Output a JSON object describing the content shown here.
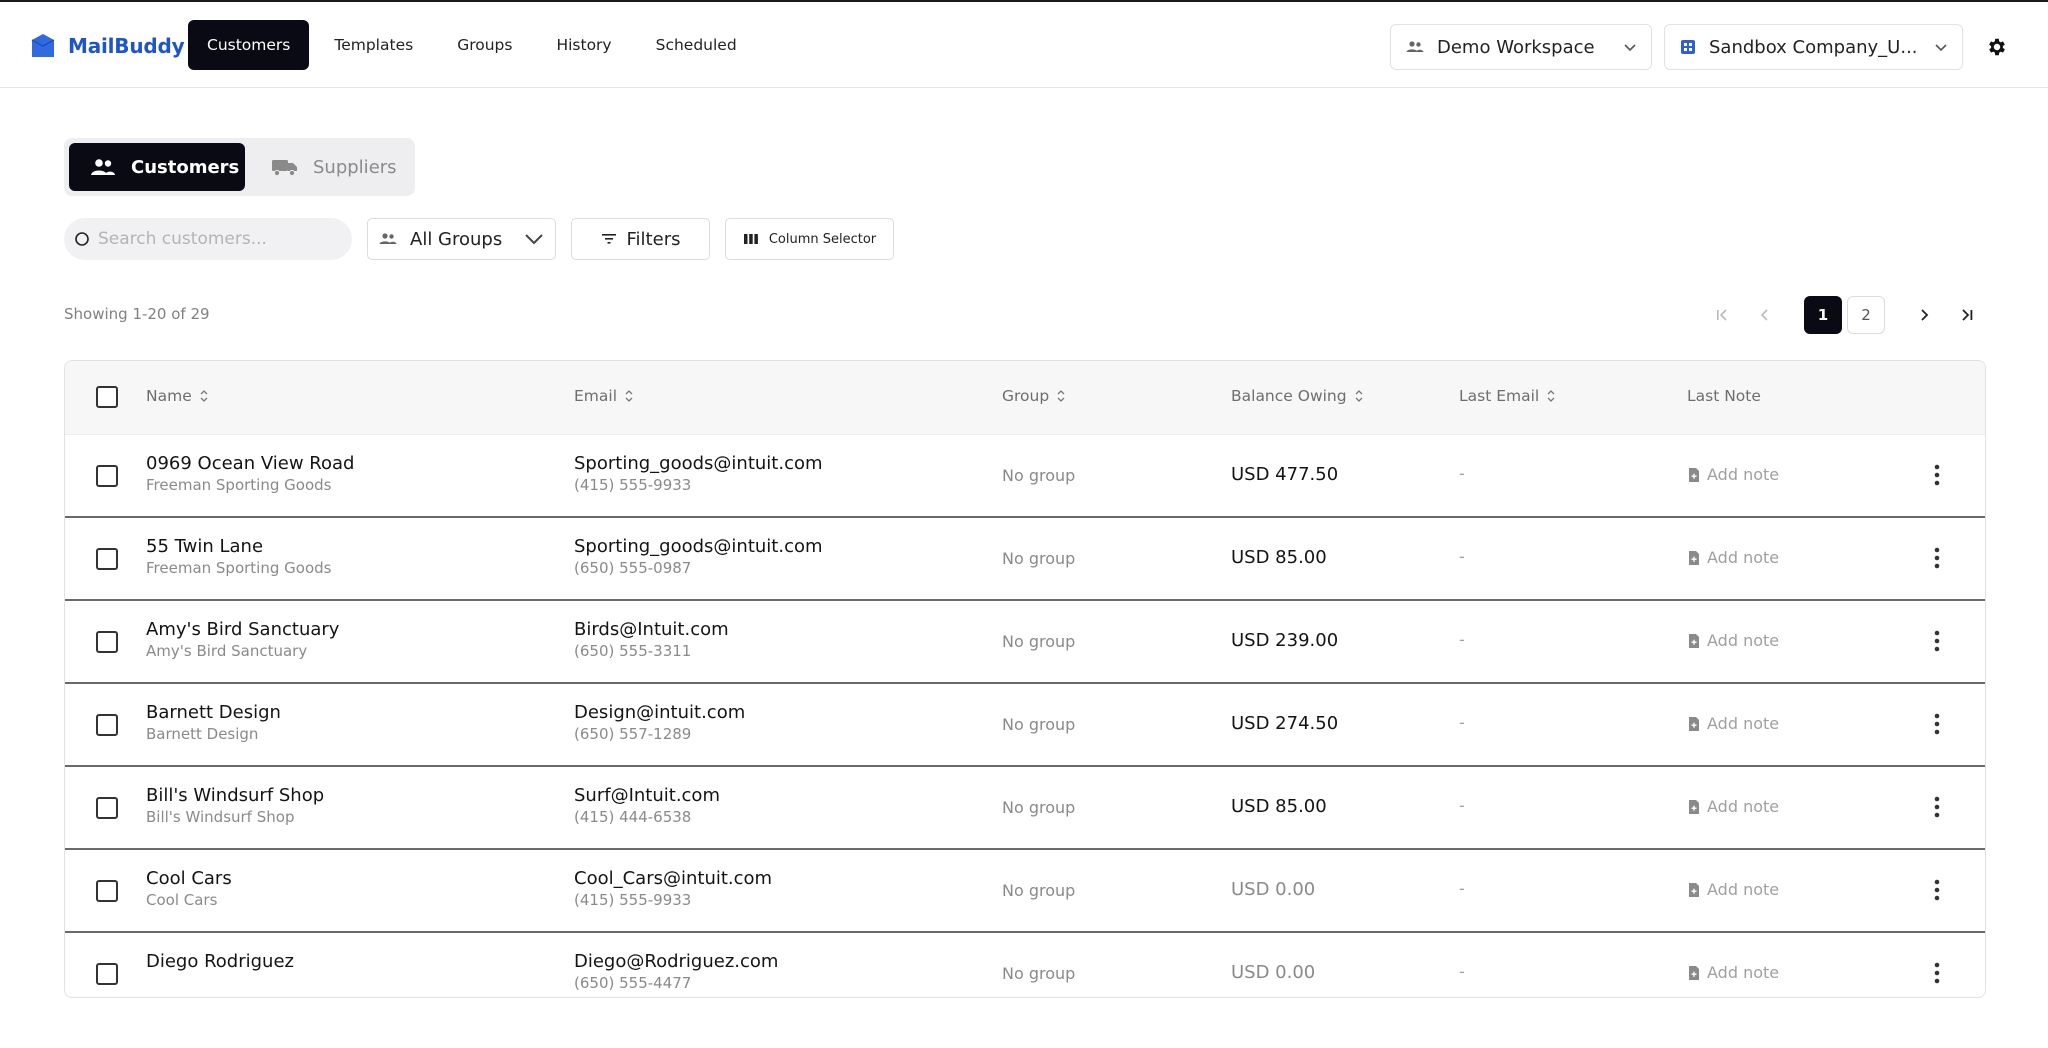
{
  "brand": {
    "name": "MailBuddy",
    "color": "#1f56c7"
  },
  "nav": {
    "items": [
      {
        "label": "Customers",
        "active": true
      },
      {
        "label": "Templates",
        "active": false
      },
      {
        "label": "Groups",
        "active": false
      },
      {
        "label": "History",
        "active": false
      },
      {
        "label": "Scheduled",
        "active": false
      }
    ]
  },
  "workspace": {
    "selected": "Demo Workspace",
    "icon": "users-icon"
  },
  "company": {
    "selected": "Sandbox Company_U...",
    "icon": "building-icon",
    "icon_color": "#2f5fd0"
  },
  "settings": {
    "icon": "gear-icon"
  },
  "segment": {
    "customers_label": "Customers",
    "suppliers_label": "Suppliers",
    "selected": "Customers"
  },
  "toolbar": {
    "search_placeholder": "Search customers...",
    "groups_label": "All Groups",
    "filters_label": "Filters",
    "column_selector_label": "Column Selector"
  },
  "list": {
    "showing": "Showing 1-20 of 29"
  },
  "pagination": {
    "current": "1",
    "next_page": "2"
  },
  "table": {
    "headers": {
      "name": "Name",
      "email": "Email",
      "group": "Group",
      "balance": "Balance Owing",
      "last_email": "Last Email",
      "last_note": "Last Note"
    },
    "rows": [
      {
        "name": "0969 Ocean View Road",
        "company": "Freeman Sporting Goods",
        "email": "Sporting_goods@intuit.com",
        "phone": "(415) 555-9933",
        "group": "No group",
        "balance": "USD 477.50",
        "last_email": "-",
        "note": "Add note"
      },
      {
        "name": "55 Twin Lane",
        "company": "Freeman Sporting Goods",
        "email": "Sporting_goods@intuit.com",
        "phone": "(650) 555-0987",
        "group": "No group",
        "balance": "USD 85.00",
        "last_email": "-",
        "note": "Add note"
      },
      {
        "name": "Amy's Bird Sanctuary",
        "company": "Amy's Bird Sanctuary",
        "email": "Birds@Intuit.com",
        "phone": "(650) 555-3311",
        "group": "No group",
        "balance": "USD 239.00",
        "last_email": "-",
        "note": "Add note"
      },
      {
        "name": "Barnett Design",
        "company": "Barnett Design",
        "email": "Design@intuit.com",
        "phone": "(650) 557-1289",
        "group": "No group",
        "balance": "USD 274.50",
        "last_email": "-",
        "note": "Add note"
      },
      {
        "name": "Bill's Windsurf Shop",
        "company": "Bill's Windsurf Shop",
        "email": "Surf@Intuit.com",
        "phone": "(415) 444-6538",
        "group": "No group",
        "balance": "USD 85.00",
        "last_email": "-",
        "note": "Add note"
      },
      {
        "name": "Cool Cars",
        "company": "Cool Cars",
        "email": "Cool_Cars@intuit.com",
        "phone": "(415) 555-9933",
        "group": "No group",
        "balance": "USD 0.00",
        "last_email": "-",
        "note": "Add note"
      },
      {
        "name": "Diego Rodriguez",
        "company": "",
        "email": "Diego@Rodriguez.com",
        "phone": "(650) 555-4477",
        "group": "No group",
        "balance": "USD 0.00",
        "last_email": "-",
        "note": "Add note"
      }
    ]
  }
}
